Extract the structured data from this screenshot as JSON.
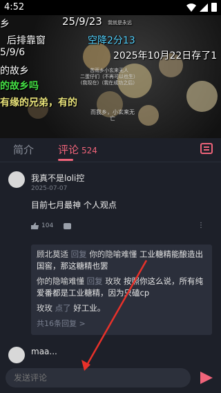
{
  "status_bar": {
    "time": "4:52"
  },
  "video": {
    "danmaku": [
      "乡",
      "25/9/23",
      "后排靠窗",
      "空降2分13",
      "5/9/6",
      "2025年10月22日存了1",
      "的故乡",
      "的故乡吗",
      "有缘的兄弟，有的"
    ],
    "small_text": [
      "我就是永远",
      "苦雨乡小玄来无人",
      "二蛋仔们（不再可以也生）",
      "(我现在)（我在成功之后）"
    ],
    "subtitle": "而我乡，小玄来无亡"
  },
  "tabs": {
    "intro": "简介",
    "comments": "评论",
    "comment_count": "524"
  },
  "comment": {
    "username": "我真不是loli控",
    "date": "2025-07-07",
    "content": "目前七月最神 个人观点",
    "likes": "104",
    "more": "⋮",
    "replies": [
      {
        "name": "顾北莫适",
        "kw": "回复",
        "target": "你的隐喻难懂",
        "text": "工业糖精能酿造出国窖，那这糖精也罢"
      },
      {
        "name": "你的隐喻难懂",
        "kw": "回复",
        "target": "玫玫",
        "text": "按照你这么说，所有纯爱番都是工业糖精，因为只磕cp"
      },
      {
        "name": "玫玫",
        "kw": "点了",
        "target": "",
        "text": "好工业。"
      }
    ],
    "more_replies": "共16条回复 >"
  },
  "comment2": {
    "username": "maa..."
  },
  "input": {
    "placeholder": "发送评论"
  },
  "colors": {
    "accent": "#f0647a",
    "background": "#1d2029",
    "panel": "#2b2f3b",
    "arrow": "#e8312a"
  }
}
